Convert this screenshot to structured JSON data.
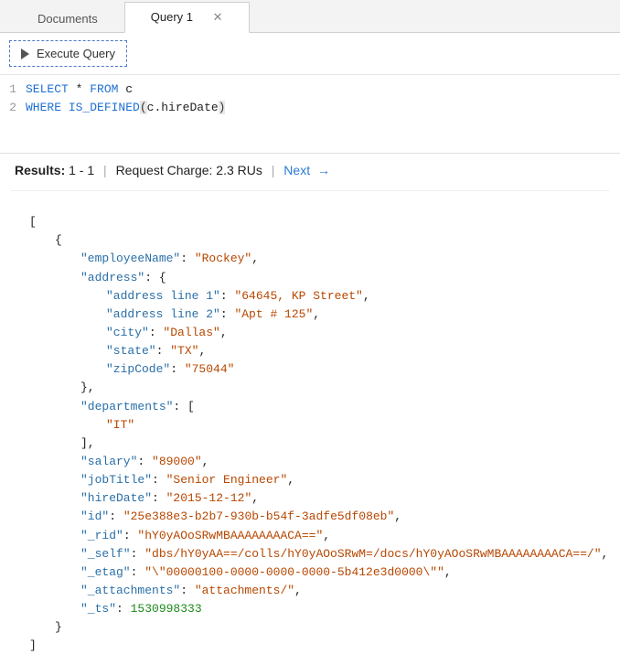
{
  "tabs": {
    "documents": "Documents",
    "query": "Query 1"
  },
  "toolbar": {
    "execute_label": "Execute Query"
  },
  "editor": {
    "line1": {
      "num": "1",
      "kw1": "SELECT",
      "star": "*",
      "kw2": "FROM",
      "alias": "c"
    },
    "line2": {
      "num": "2",
      "kw": "WHERE",
      "fn": "IS_DEFINED",
      "arg": "c.hireDate"
    }
  },
  "results_bar": {
    "label": "Results:",
    "range": "1 - 1",
    "charge_label": "Request Charge:",
    "charge_value": "2.3 RUs",
    "next": "Next"
  },
  "json": {
    "employeeName_k": "\"employeeName\"",
    "employeeName_v": "\"Rockey\"",
    "address_k": "\"address\"",
    "addr_line1_k": "\"address line 1\"",
    "addr_line1_v": "\"64645, KP Street\"",
    "addr_line2_k": "\"address line 2\"",
    "addr_line2_v": "\"Apt # 125\"",
    "city_k": "\"city\"",
    "city_v": "\"Dallas\"",
    "state_k": "\"state\"",
    "state_v": "\"TX\"",
    "zip_k": "\"zipCode\"",
    "zip_v": "\"75044\"",
    "departments_k": "\"departments\"",
    "dept0_v": "\"IT\"",
    "salary_k": "\"salary\"",
    "salary_v": "\"89000\"",
    "jobTitle_k": "\"jobTitle\"",
    "jobTitle_v": "\"Senior Engineer\"",
    "hireDate_k": "\"hireDate\"",
    "hireDate_v": "\"2015-12-12\"",
    "id_k": "\"id\"",
    "id_v": "\"25e388e3-b2b7-930b-b54f-3adfe5df08eb\"",
    "rid_k": "\"_rid\"",
    "rid_v": "\"hY0yAOoSRwMBAAAAAAAACA==\"",
    "self_k": "\"_self\"",
    "self_v": "\"dbs/hY0yAA==/colls/hY0yAOoSRwM=/docs/hY0yAOoSRwMBAAAAAAAACA==/\"",
    "etag_k": "\"_etag\"",
    "etag_v": "\"\\\"00000100-0000-0000-0000-5b412e3d0000\\\"\"",
    "attachments_k": "\"_attachments\"",
    "attachments_v": "\"attachments/\"",
    "ts_k": "\"_ts\"",
    "ts_v": "1530998333"
  }
}
